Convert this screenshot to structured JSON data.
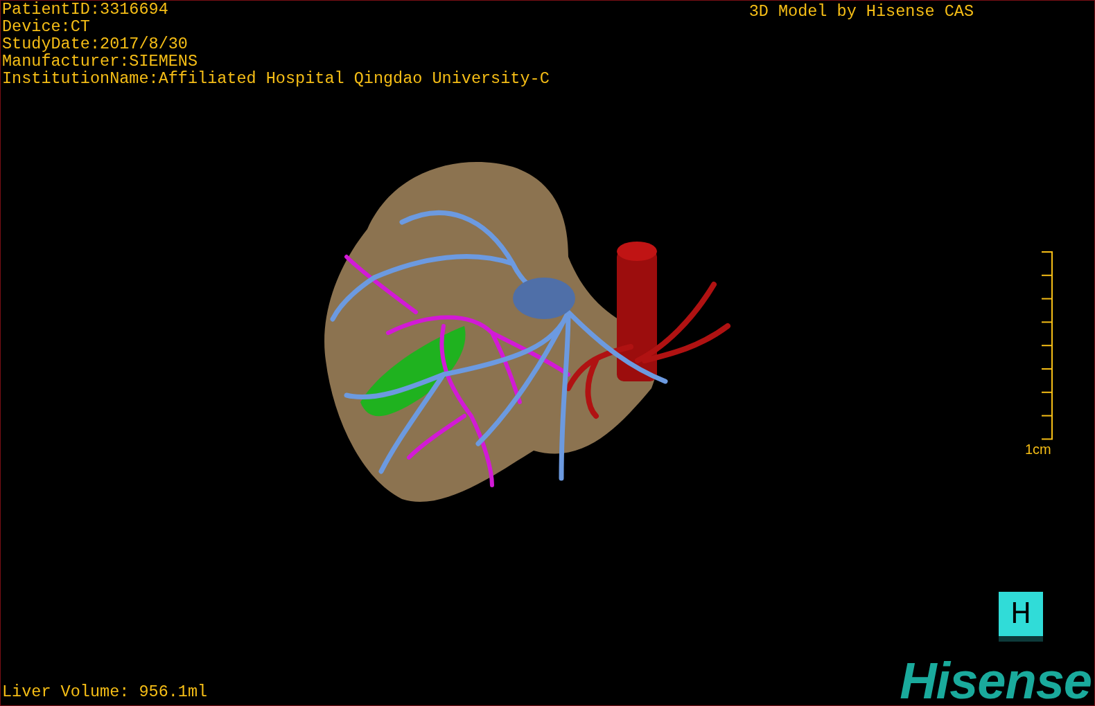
{
  "patient_info": [
    "PatientID:3316694",
    "Device:CT",
    "StudyDate:2017/8/30",
    "Manufacturer:SIEMENS",
    "InstitutionName:Affiliated Hospital Qingdao University-C"
  ],
  "header": {
    "title": "3D Model by Hisense CAS"
  },
  "scale_bar": {
    "label": "1cm"
  },
  "orientation_cube": {
    "label": "H"
  },
  "liver_volume": "Liver Volume: 956.1ml",
  "logo": "Hisense"
}
